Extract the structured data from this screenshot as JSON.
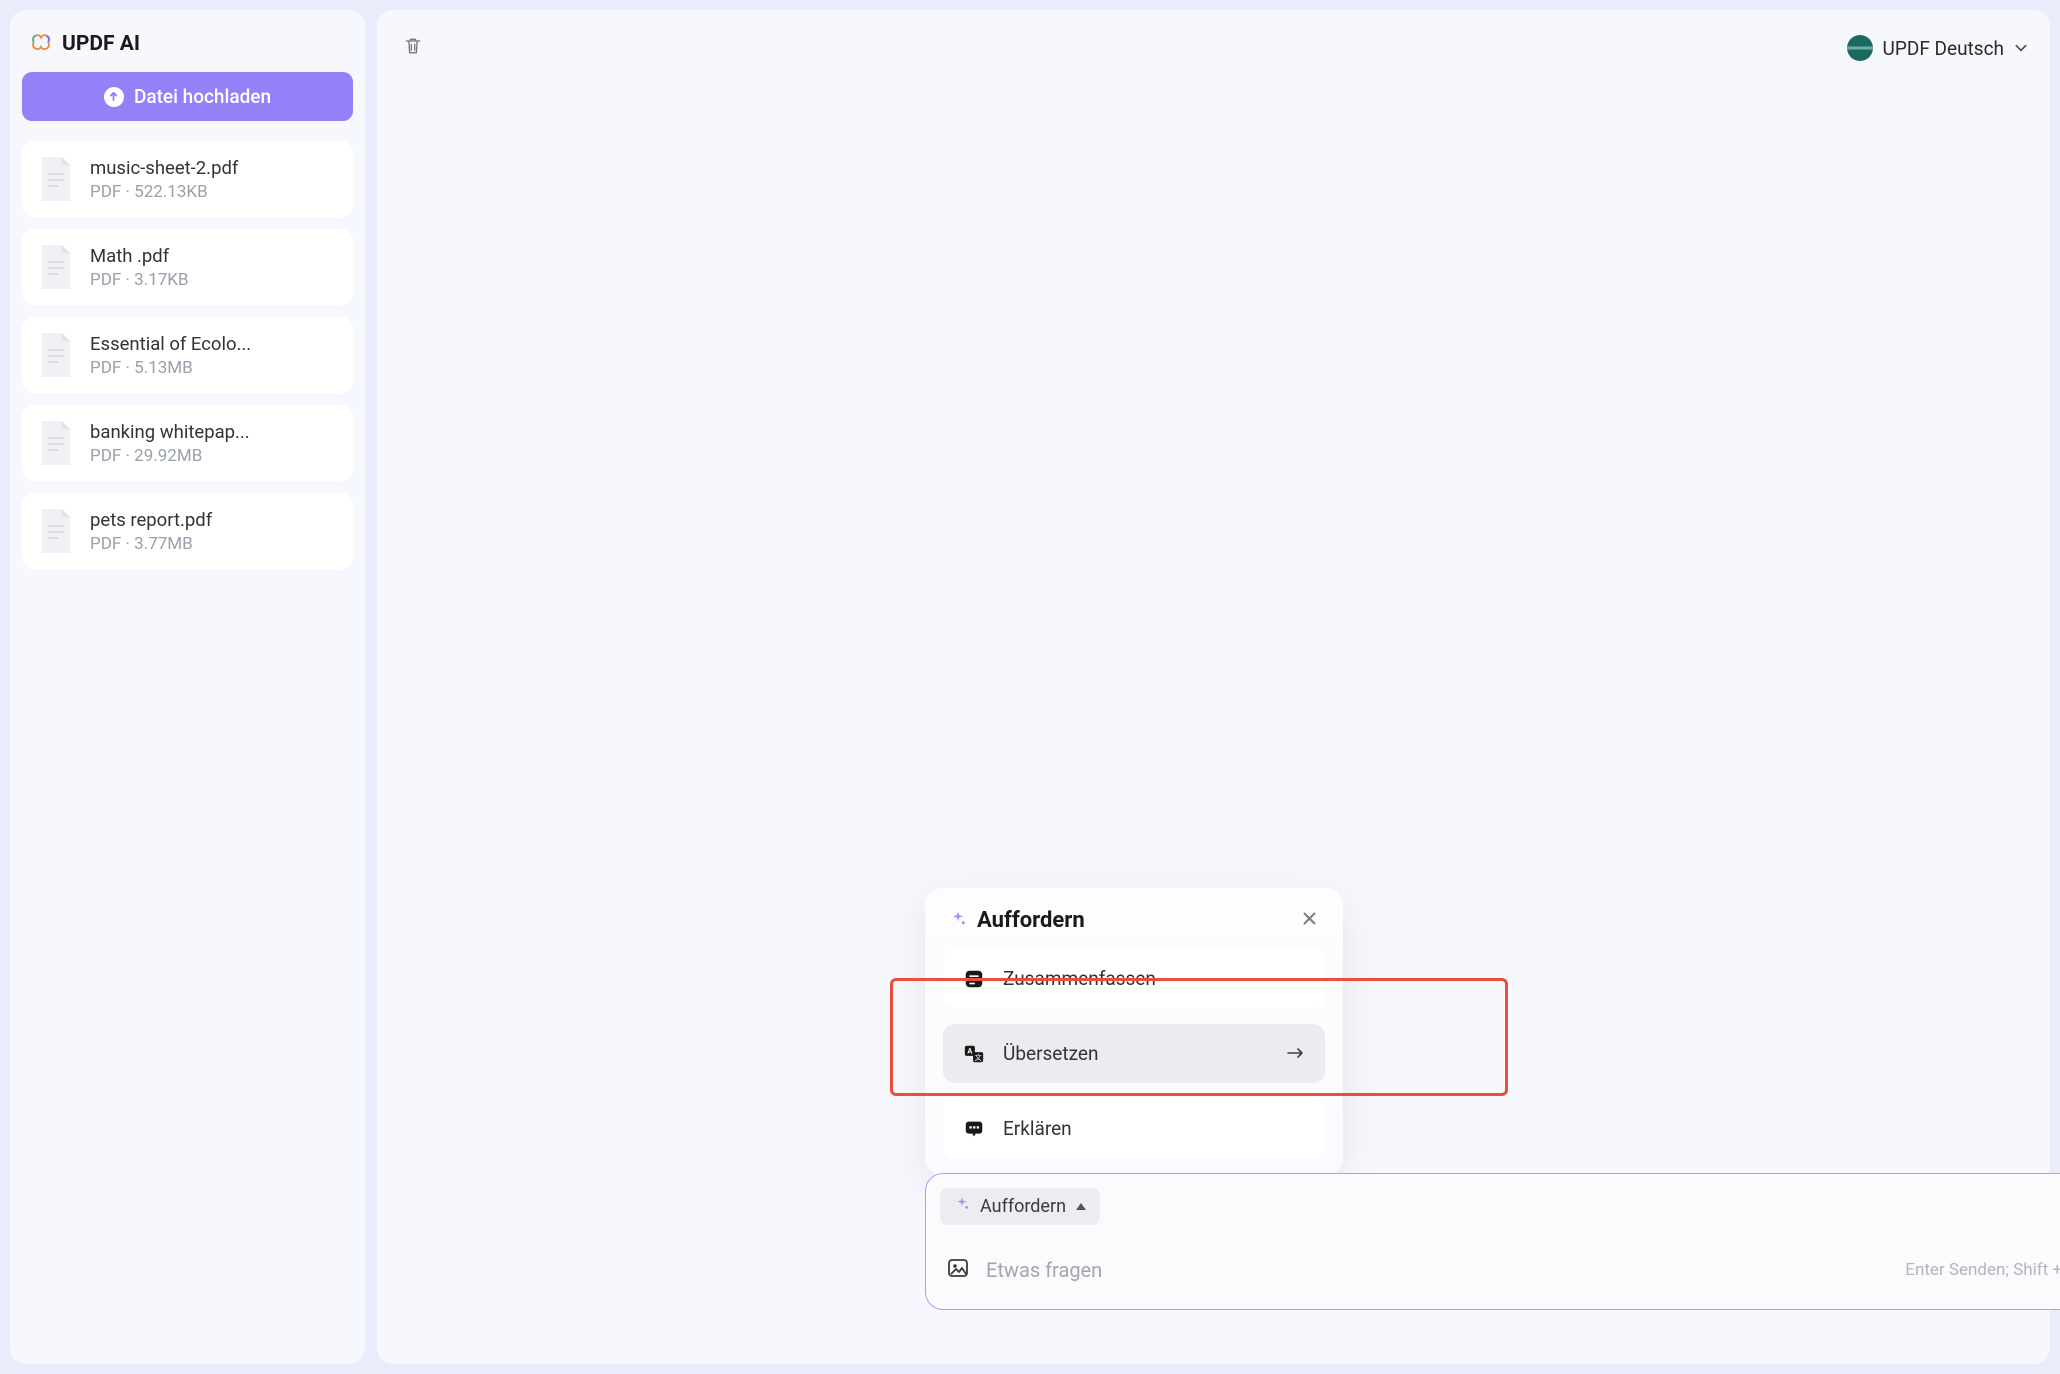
{
  "brand": {
    "title": "UPDF AI"
  },
  "sidebar": {
    "upload_label": "Datei hochladen",
    "files": [
      {
        "name": "music-sheet-2.pdf",
        "meta": "PDF · 522.13KB"
      },
      {
        "name": "Math .pdf",
        "meta": "PDF · 3.17KB"
      },
      {
        "name": "Essential of Ecolo...",
        "meta": "PDF · 5.13MB"
      },
      {
        "name": "banking whitepap...",
        "meta": "PDF · 29.92MB"
      },
      {
        "name": "pets report.pdf",
        "meta": "PDF · 3.77MB"
      }
    ]
  },
  "header": {
    "language_label": "UPDF Deutsch"
  },
  "prompt_popup": {
    "title": "Auffordern",
    "options": [
      {
        "label": "Zusammenfassen"
      },
      {
        "label": "Übersetzen"
      },
      {
        "label": "Erklären"
      }
    ]
  },
  "composer": {
    "chip_label": "Auffordern",
    "placeholder": "Etwas fragen",
    "hint": "Enter Senden; Shift + Enter Neue Zeile"
  }
}
